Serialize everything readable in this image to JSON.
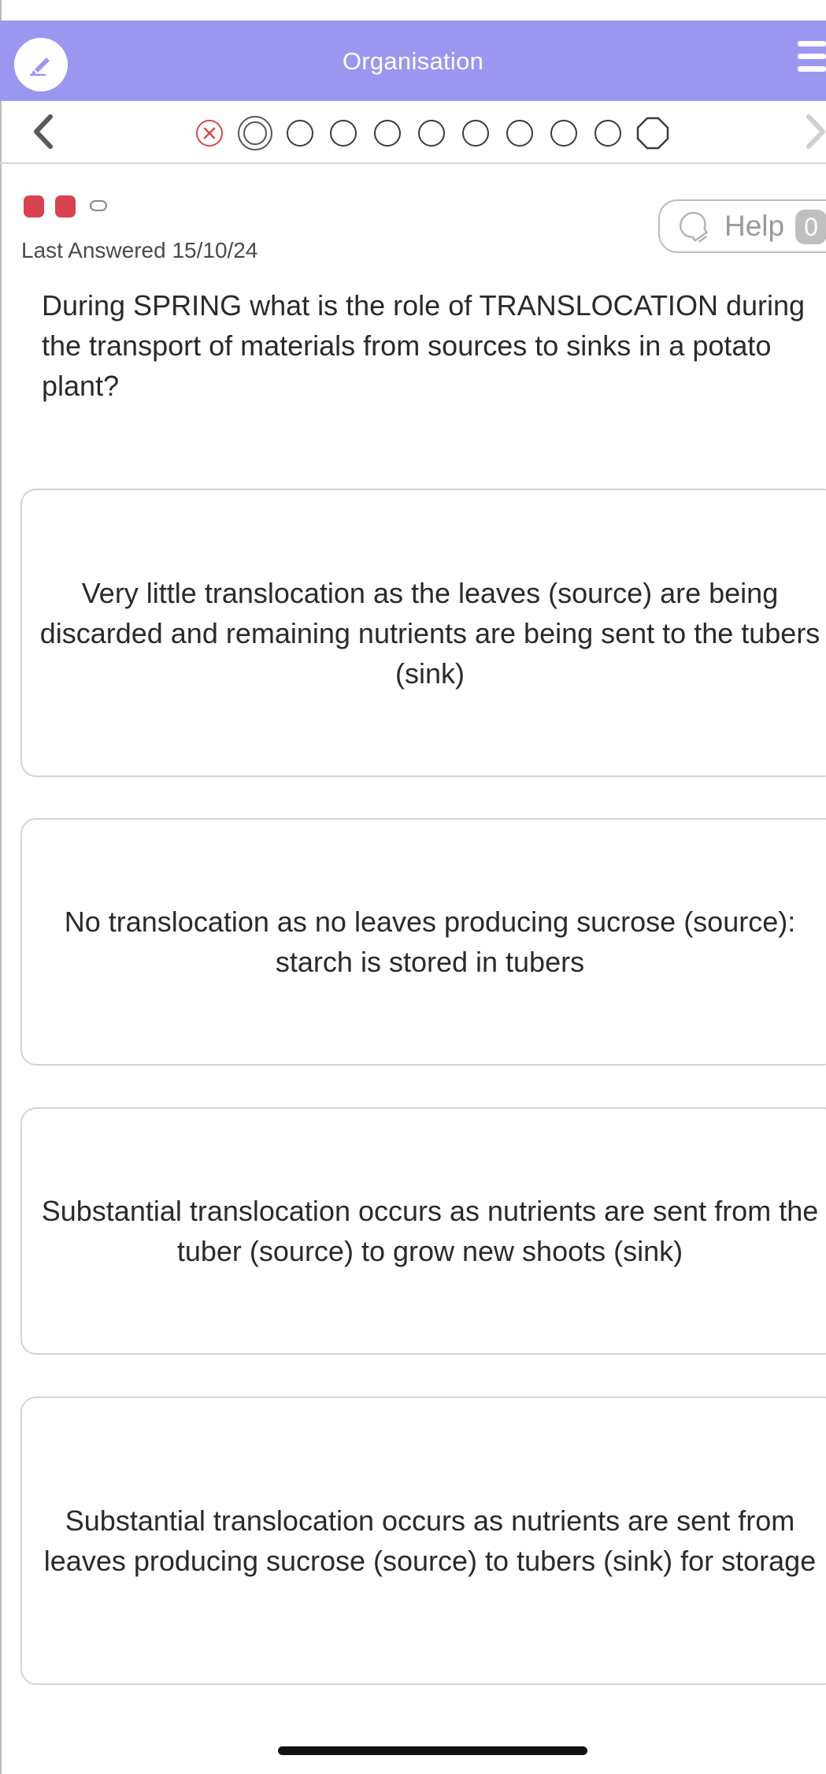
{
  "header": {
    "title": "Organisation",
    "accent_color": "#9b97f1",
    "logo_icon": "pencil-edit-icon",
    "menu_icon": "hamburger-menu-icon"
  },
  "progress": {
    "back_icon": "chevron-left-icon",
    "forward_icon": "chevron-right-icon",
    "steps": [
      {
        "state": "wrong",
        "icon": "x-circle-icon"
      },
      {
        "state": "current"
      },
      {
        "state": "pending"
      },
      {
        "state": "pending"
      },
      {
        "state": "pending"
      },
      {
        "state": "pending"
      },
      {
        "state": "pending"
      },
      {
        "state": "pending"
      },
      {
        "state": "pending"
      },
      {
        "state": "pending"
      },
      {
        "state": "final",
        "icon": "octagon-icon"
      }
    ]
  },
  "status": {
    "attempt_markers": [
      "filled",
      "filled",
      "empty"
    ],
    "marker_color": "#d94250",
    "last_answered": "Last Answered 15/10/24"
  },
  "help": {
    "label": "Help",
    "count": "0",
    "icon": "lightbulb-icon"
  },
  "question": {
    "text": "During SPRING what is the role of TRANSLOCATION during the transport of materials from sources to sinks in a potato plant?"
  },
  "options": [
    {
      "text": "Very little translocation as the leaves (source) are being discarded and remaining nutrients are being sent to the tubers (sink)"
    },
    {
      "text": "No translocation as no leaves producing sucrose (source): starch is stored in tubers"
    },
    {
      "text": "Substantial translocation occurs as nutrients are sent from the tuber (source) to grow new shoots (sink)"
    },
    {
      "text": "Substantial translocation occurs as nutrients are sent from leaves producing sucrose (source) to tubers (sink) for storage"
    }
  ]
}
